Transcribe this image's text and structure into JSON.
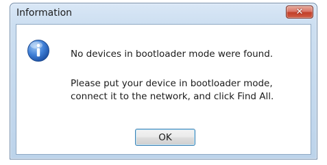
{
  "window": {
    "title": "Information",
    "close_icon": "close-icon"
  },
  "dialog": {
    "icon": "info-icon",
    "message_line1": "No devices in bootloader mode were found.",
    "message_line2": "Please put your device in bootloader mode,",
    "message_line3": "connect it to the network, and click Find All.",
    "ok_label": "OK"
  }
}
